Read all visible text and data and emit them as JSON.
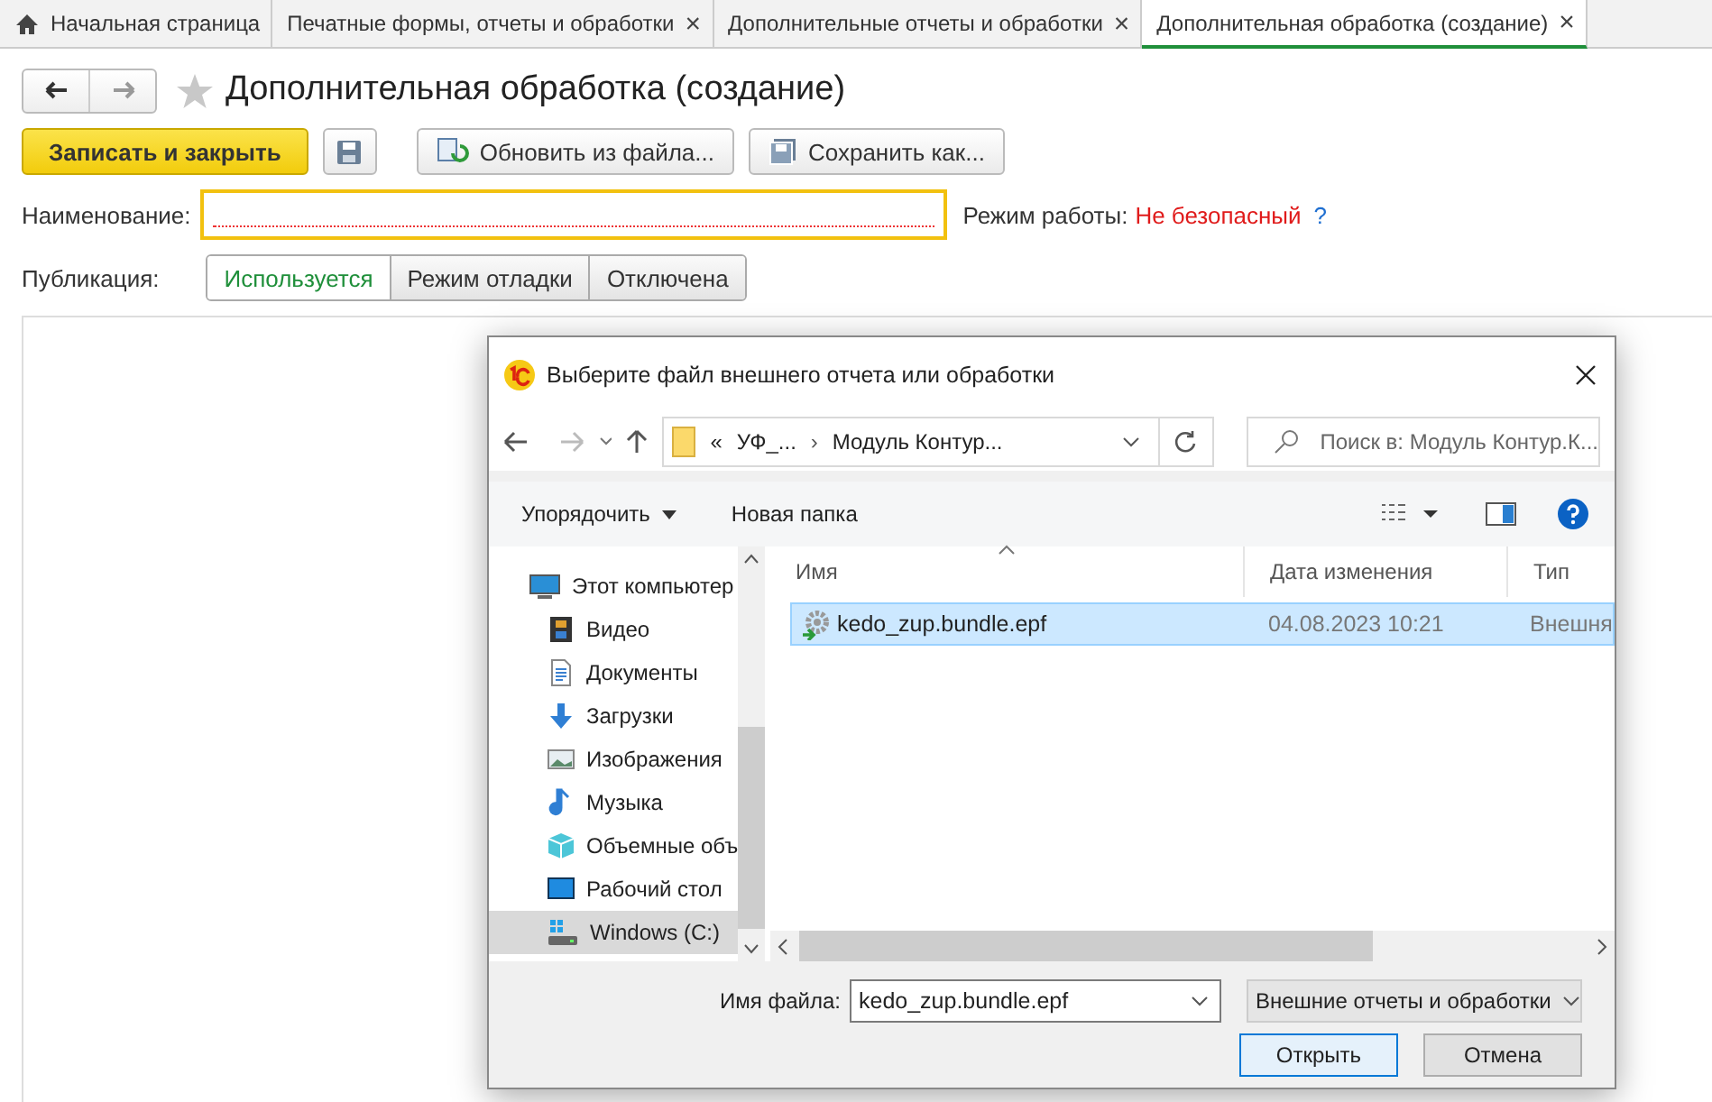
{
  "tabs": [
    {
      "kind": "home",
      "label": "Начальная страница",
      "selected": false
    },
    {
      "kind": "page",
      "label": "Печатные формы, отчеты и обработки",
      "close": "×",
      "selected": false
    },
    {
      "kind": "page",
      "label": "Дополнительные отчеты и обработки",
      "close": "×",
      "selected": false
    },
    {
      "kind": "page",
      "label": "Дополнительная обработка (создание)",
      "close": "×",
      "selected": true
    }
  ],
  "form": {
    "title": "Дополнительная обработка (создание)",
    "favorite": false,
    "buttons": [
      {
        "kind": "primary",
        "label": "Записать и закрыть"
      },
      {
        "kind": "save"
      },
      {
        "kind": "reload",
        "label": "Обновить из файла..."
      },
      {
        "kind": "saveas",
        "label": "Сохранить как..."
      }
    ],
    "name": {
      "label": "Наименование:",
      "required": true
    },
    "mode": {
      "label": "Режим работы:",
      "value": "Не безопасный",
      "help": "?"
    },
    "publication": {
      "label": "Публикация:",
      "options": [
        {
          "label": "Используется",
          "selected": true
        },
        {
          "label": "Режим отладки",
          "selected": false
        },
        {
          "label": "Отключена",
          "selected": false
        }
      ]
    }
  },
  "dialog": {
    "title": "Выберите файл внешнего отчета или обработки",
    "path": {
      "prefix": "«",
      "segments": [
        "УФ_...",
        "Модуль Контур..."
      ],
      "separator": "›"
    },
    "search": {
      "placeholder": "Поиск в: Модуль Контур.К..."
    },
    "toolbar": {
      "organize": "Упорядочить",
      "new_folder": "Новая папка"
    },
    "nav": [
      {
        "kind": "computer",
        "label": "Этот компьютер",
        "selected": false,
        "children": [
          {
            "kind": "video",
            "label": "Видео",
            "selected": false
          },
          {
            "kind": "docs",
            "label": "Документы",
            "selected": false
          },
          {
            "kind": "downloads",
            "label": "Загрузки",
            "selected": false
          },
          {
            "kind": "images",
            "label": "Изображения",
            "selected": false
          },
          {
            "kind": "music",
            "label": "Музыка",
            "selected": false
          },
          {
            "kind": "objects3d",
            "label": "Объемные объ",
            "selected": false
          },
          {
            "kind": "desktop",
            "label": "Рабочий стол",
            "selected": false
          },
          {
            "kind": "drive",
            "label": "Windows (C:)",
            "selected": true
          }
        ]
      }
    ],
    "columns": [
      {
        "label": "Имя",
        "sorted": true
      },
      {
        "label": "Дата изменения",
        "sorted": false
      },
      {
        "label": "Тип",
        "sorted": false
      }
    ],
    "files": [
      {
        "name": "kedo_zup.bundle.epf",
        "date": "04.08.2023 10:21",
        "type": "Внешня",
        "selected": true
      }
    ],
    "filename": {
      "label": "Имя файла:",
      "value": "kedo_zup.bundle.epf"
    },
    "filter": "Внешние отчеты и обработки",
    "buttons": [
      {
        "kind": "default",
        "label": "Открыть"
      },
      {
        "kind": "normal",
        "label": "Отмена"
      }
    ]
  }
}
